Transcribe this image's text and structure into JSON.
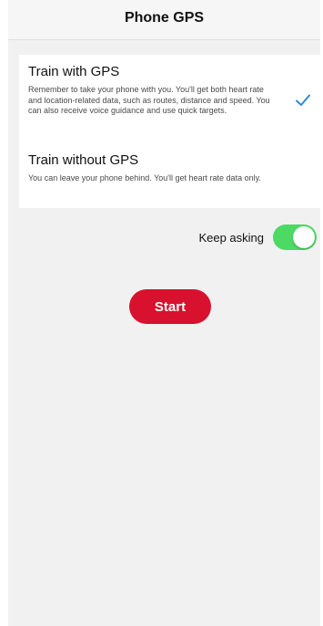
{
  "header": {
    "title": "Phone GPS"
  },
  "options": [
    {
      "title": "Train with GPS",
      "description": "Remember to take your phone with you. You'll get both heart rate and location-related data, such as routes, distance and speed. You can also receive voice guidance and use quick targets.",
      "selected": true
    },
    {
      "title": "Train without GPS",
      "description": "You can leave your phone behind. You'll get heart rate data only.",
      "selected": false
    }
  ],
  "keep_asking": {
    "label": "Keep asking",
    "on": true
  },
  "start_button": {
    "label": "Start"
  },
  "colors": {
    "accent_red": "#d8112e",
    "toggle_green": "#4cd964",
    "check_blue": "#2f8ad8",
    "background": "#f1f1f1"
  },
  "icons": {
    "selected_option": "checkmark-icon"
  }
}
